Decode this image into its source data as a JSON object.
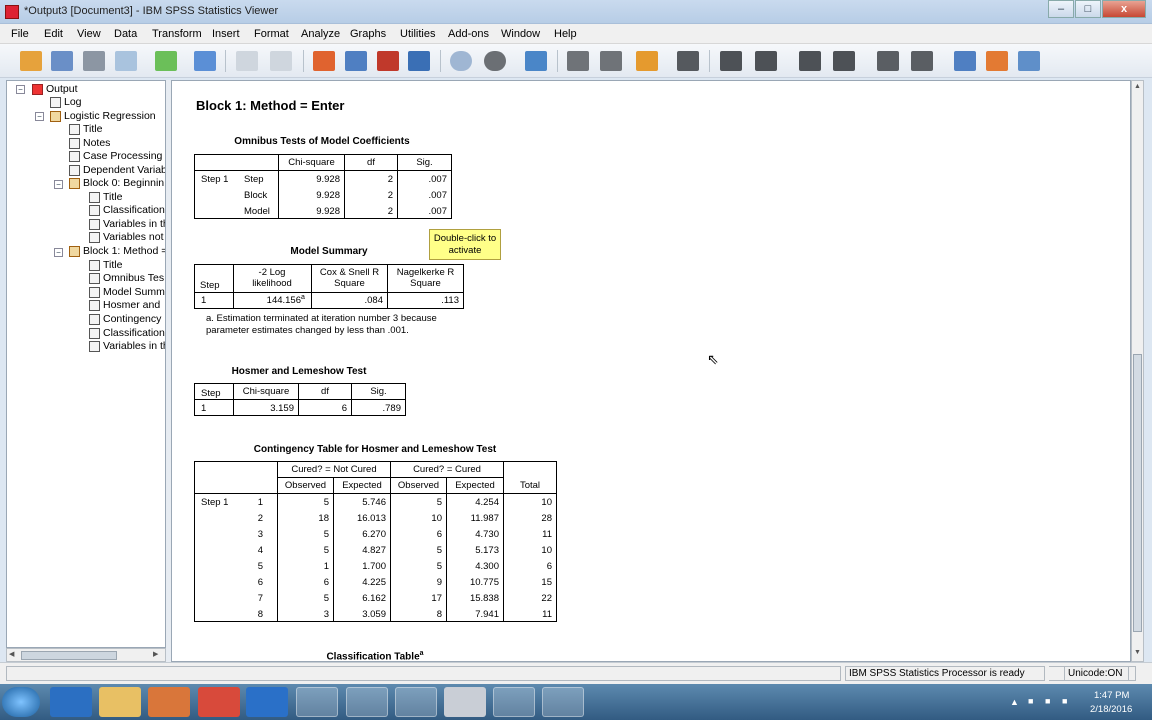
{
  "window": {
    "title": "*Output3 [Document3] - IBM SPSS Statistics Viewer",
    "minimize": "–",
    "maximize": "□",
    "close": "x"
  },
  "menu": [
    "File",
    "Edit",
    "View",
    "Data",
    "Transform",
    "Insert",
    "Format",
    "Analyze",
    "Graphs",
    "Utilities",
    "Add-ons",
    "Window",
    "Help"
  ],
  "nav_tree": [
    "Output",
    "Log",
    "Logistic Regression",
    "Title",
    "Notes",
    "Case Processing",
    "Dependent Variab",
    "Block 0: Beginnin",
    "Title",
    "Classification",
    "Variables in th",
    "Variables not",
    "Block 1: Method =",
    "Title",
    "Omnibus Tes",
    "Model Summ",
    "Hosmer and",
    "Contingency",
    "Classification",
    "Variables in th"
  ],
  "content": {
    "heading": "Block 1: Method = Enter",
    "omnibus": {
      "title": "Omnibus Tests of Model Coefficients",
      "headers": [
        "Chi-square",
        "df",
        "Sig."
      ],
      "step_label": "Step 1",
      "rows": [
        [
          "Step",
          "9.928",
          "2",
          ".007"
        ],
        [
          "Block",
          "9.928",
          "2",
          ".007"
        ],
        [
          "Model",
          "9.928",
          "2",
          ".007"
        ]
      ]
    },
    "tooltip": "Double-click to activate",
    "model_summary": {
      "title": "Model Summary",
      "headers": [
        "Step",
        "-2 Log likelihood",
        "Cox & Snell R Square",
        "Nagelkerke R Square"
      ],
      "row": [
        "1",
        "144.156",
        "a",
        ".084",
        ".113"
      ],
      "footnote": "a. Estimation terminated at iteration number 3 because parameter estimates changed by less than .001."
    },
    "hosmer": {
      "title": "Hosmer and Lemeshow Test",
      "headers": [
        "Step",
        "Chi-square",
        "df",
        "Sig."
      ],
      "row": [
        "1",
        "3.159",
        "6",
        ".789"
      ]
    },
    "contingency": {
      "title": "Contingency Table for Hosmer and Lemeshow Test",
      "group1": "Cured? = Not Cured",
      "group2": "Cured? = Cured",
      "sub": [
        "Observed",
        "Expected",
        "Observed",
        "Expected"
      ],
      "total": "Total",
      "step_label": "Step 1",
      "rows": [
        [
          "1",
          "5",
          "5.746",
          "5",
          "4.254",
          "10"
        ],
        [
          "2",
          "18",
          "16.013",
          "10",
          "11.987",
          "28"
        ],
        [
          "3",
          "5",
          "6.270",
          "6",
          "4.730",
          "11"
        ],
        [
          "4",
          "5",
          "4.827",
          "5",
          "5.173",
          "10"
        ],
        [
          "5",
          "1",
          "1.700",
          "5",
          "4.300",
          "6"
        ],
        [
          "6",
          "6",
          "4.225",
          "9",
          "10.775",
          "15"
        ],
        [
          "7",
          "5",
          "6.162",
          "17",
          "15.838",
          "22"
        ],
        [
          "8",
          "3",
          "3.059",
          "8",
          "7.941",
          "11"
        ]
      ]
    },
    "classification_title": "Classification Table",
    "classification_sup": "a"
  },
  "status": {
    "processor": "IBM SPSS Statistics Processor is ready",
    "unicode": "Unicode:ON"
  },
  "clock": {
    "time": "1:47 PM",
    "date": "2/18/2016"
  },
  "colors": {
    "accent": "#b7cde6",
    "tooltip": "#ffff88",
    "taskbar": "#325b82"
  }
}
